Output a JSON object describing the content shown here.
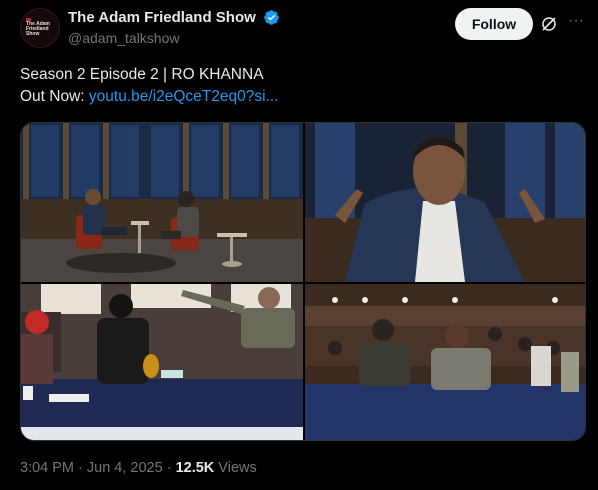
{
  "author": {
    "display_name": "The Adam Friedland Show",
    "handle": "@adam_talkshow",
    "avatar_text": "The Adam Friedland Show",
    "verified": true
  },
  "actions": {
    "follow_label": "Follow",
    "grok_icon": "grok-icon",
    "more_icon": "more-horizontal-icon",
    "more_glyph": "···"
  },
  "tweet": {
    "line1": "Season 2 Episode 2 | RO KHANNA",
    "line2_prefix": "Out Now: ",
    "link_text": "youtu.be/i2eQceT2eq0?si..."
  },
  "media": [
    {
      "name": "media-photo-1",
      "description_icon": "interview-two-chairs"
    },
    {
      "name": "media-photo-2",
      "description_icon": "guest-closeup"
    },
    {
      "name": "media-photo-3",
      "description_icon": "hearing-table-left"
    },
    {
      "name": "media-photo-4",
      "description_icon": "hearing-table-right"
    }
  ],
  "meta": {
    "time": "3:04 PM",
    "sep1": " · ",
    "date": "Jun 4, 2025",
    "sep2": " · ",
    "views_count": "12.5K",
    "views_label": " Views"
  },
  "colors": {
    "link": "#1d9bf0",
    "verified": "#1d9bf0",
    "muted": "#71767b",
    "text": "#e7e9ea",
    "background": "#000000"
  }
}
